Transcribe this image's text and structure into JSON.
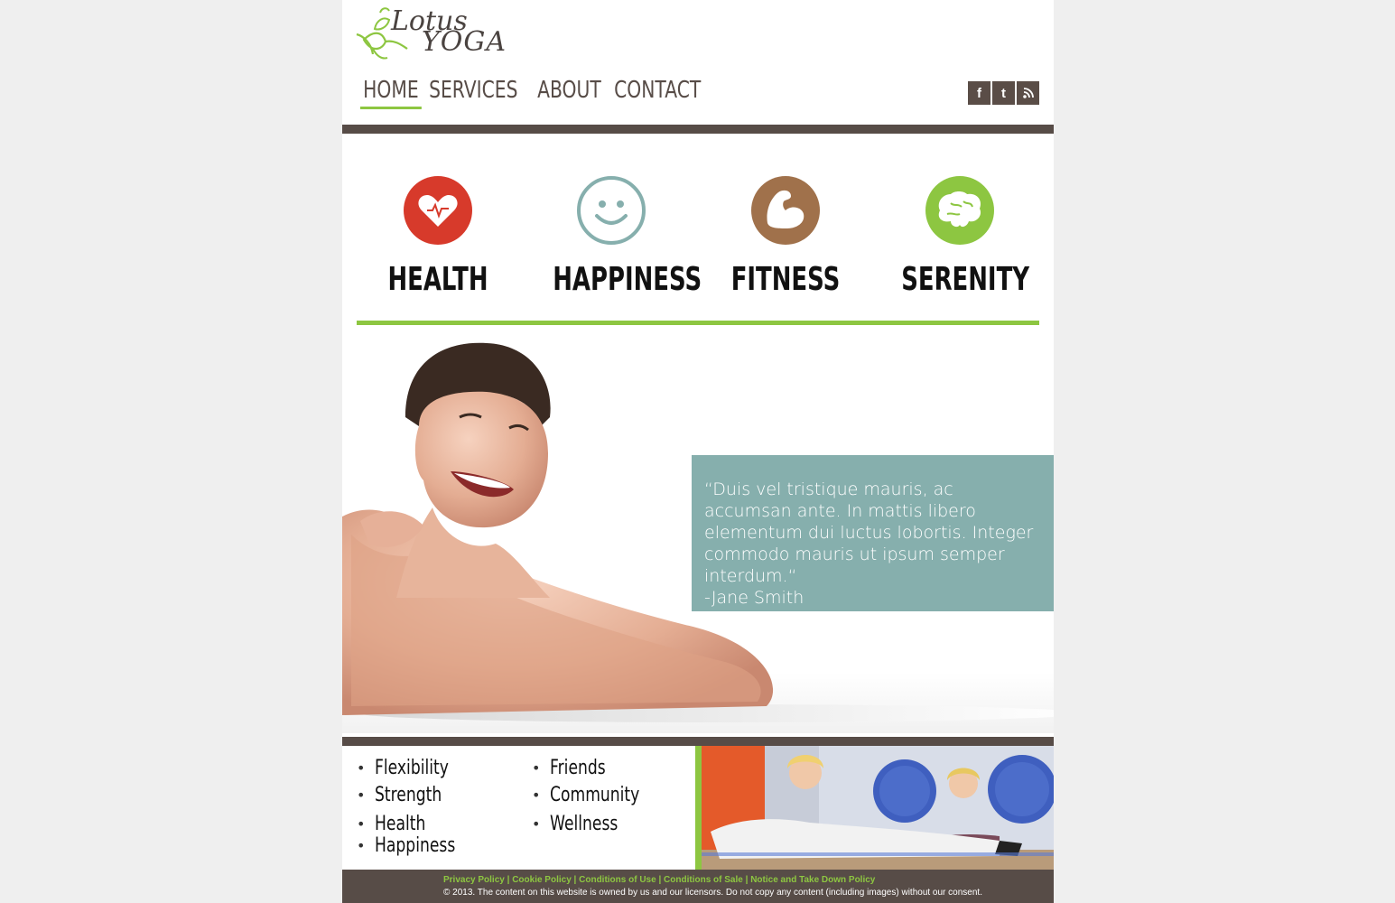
{
  "brand": {
    "logo_line1": "Lotus",
    "logo_line2": "YOGA",
    "accent_green": "#8dc641",
    "brown": "#574c47",
    "teal": "#86afad"
  },
  "nav": {
    "items": [
      {
        "label": "HOME",
        "active": true
      },
      {
        "label": "SERVICES",
        "active": false
      },
      {
        "label": "ABOUT",
        "active": false
      },
      {
        "label": "CONTACT",
        "active": false
      }
    ]
  },
  "social": [
    {
      "icon": "facebook-icon",
      "glyph": "f"
    },
    {
      "icon": "twitter-icon",
      "glyph": "t"
    },
    {
      "icon": "rss-icon",
      "glyph": "⊙"
    }
  ],
  "features": [
    {
      "label": "HEALTH",
      "icon": "heart-icon",
      "color": "#d73a2b"
    },
    {
      "label": "HAPPINESS",
      "icon": "smiley-icon",
      "color": "#86afad"
    },
    {
      "label": "FITNESS",
      "icon": "bicep-icon",
      "color": "#a0714b"
    },
    {
      "label": "SERENITY",
      "icon": "brain-icon",
      "color": "#8dc641"
    }
  ],
  "quote": {
    "text": "“Duis vel tristique mauris, ac accumsan ante. In mattis libero elementum dui luctus lobortis. Integer commodo mauris ut ipsum semper interdum.“",
    "author": "-Jane Smith"
  },
  "lists": {
    "left": [
      "Flexibility",
      "Strength",
      "Health",
      "Happiness"
    ],
    "right": [
      "Friends",
      "Community",
      "Wellness"
    ]
  },
  "footer": {
    "links": [
      "Privacy Policy",
      "Cookie Policy",
      "Conditions of Use",
      "Conditions of Sale",
      "Notice and Take Down Policy"
    ],
    "separator": " | ",
    "copyright": "© 2013. The content on this website is owned by us and our licensors. Do not copy any content (including images) without our consent."
  }
}
